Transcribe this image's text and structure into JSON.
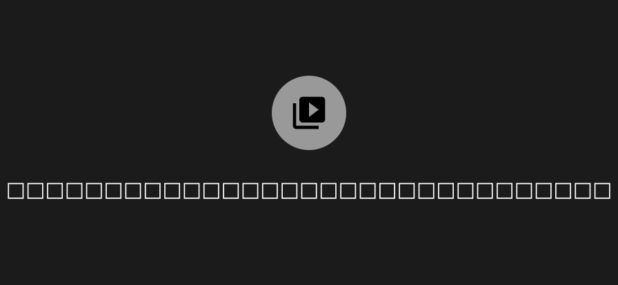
{
  "empty_state": {
    "icon": "video-library-icon",
    "message": "□□□□□□□□□□□□□□□□□□□□□□□□□□□□□□□",
    "colors": {
      "background": "#1b1b1b",
      "icon_circle": "#999999",
      "icon_glyph": "#000000",
      "text": "#ffffff"
    }
  }
}
